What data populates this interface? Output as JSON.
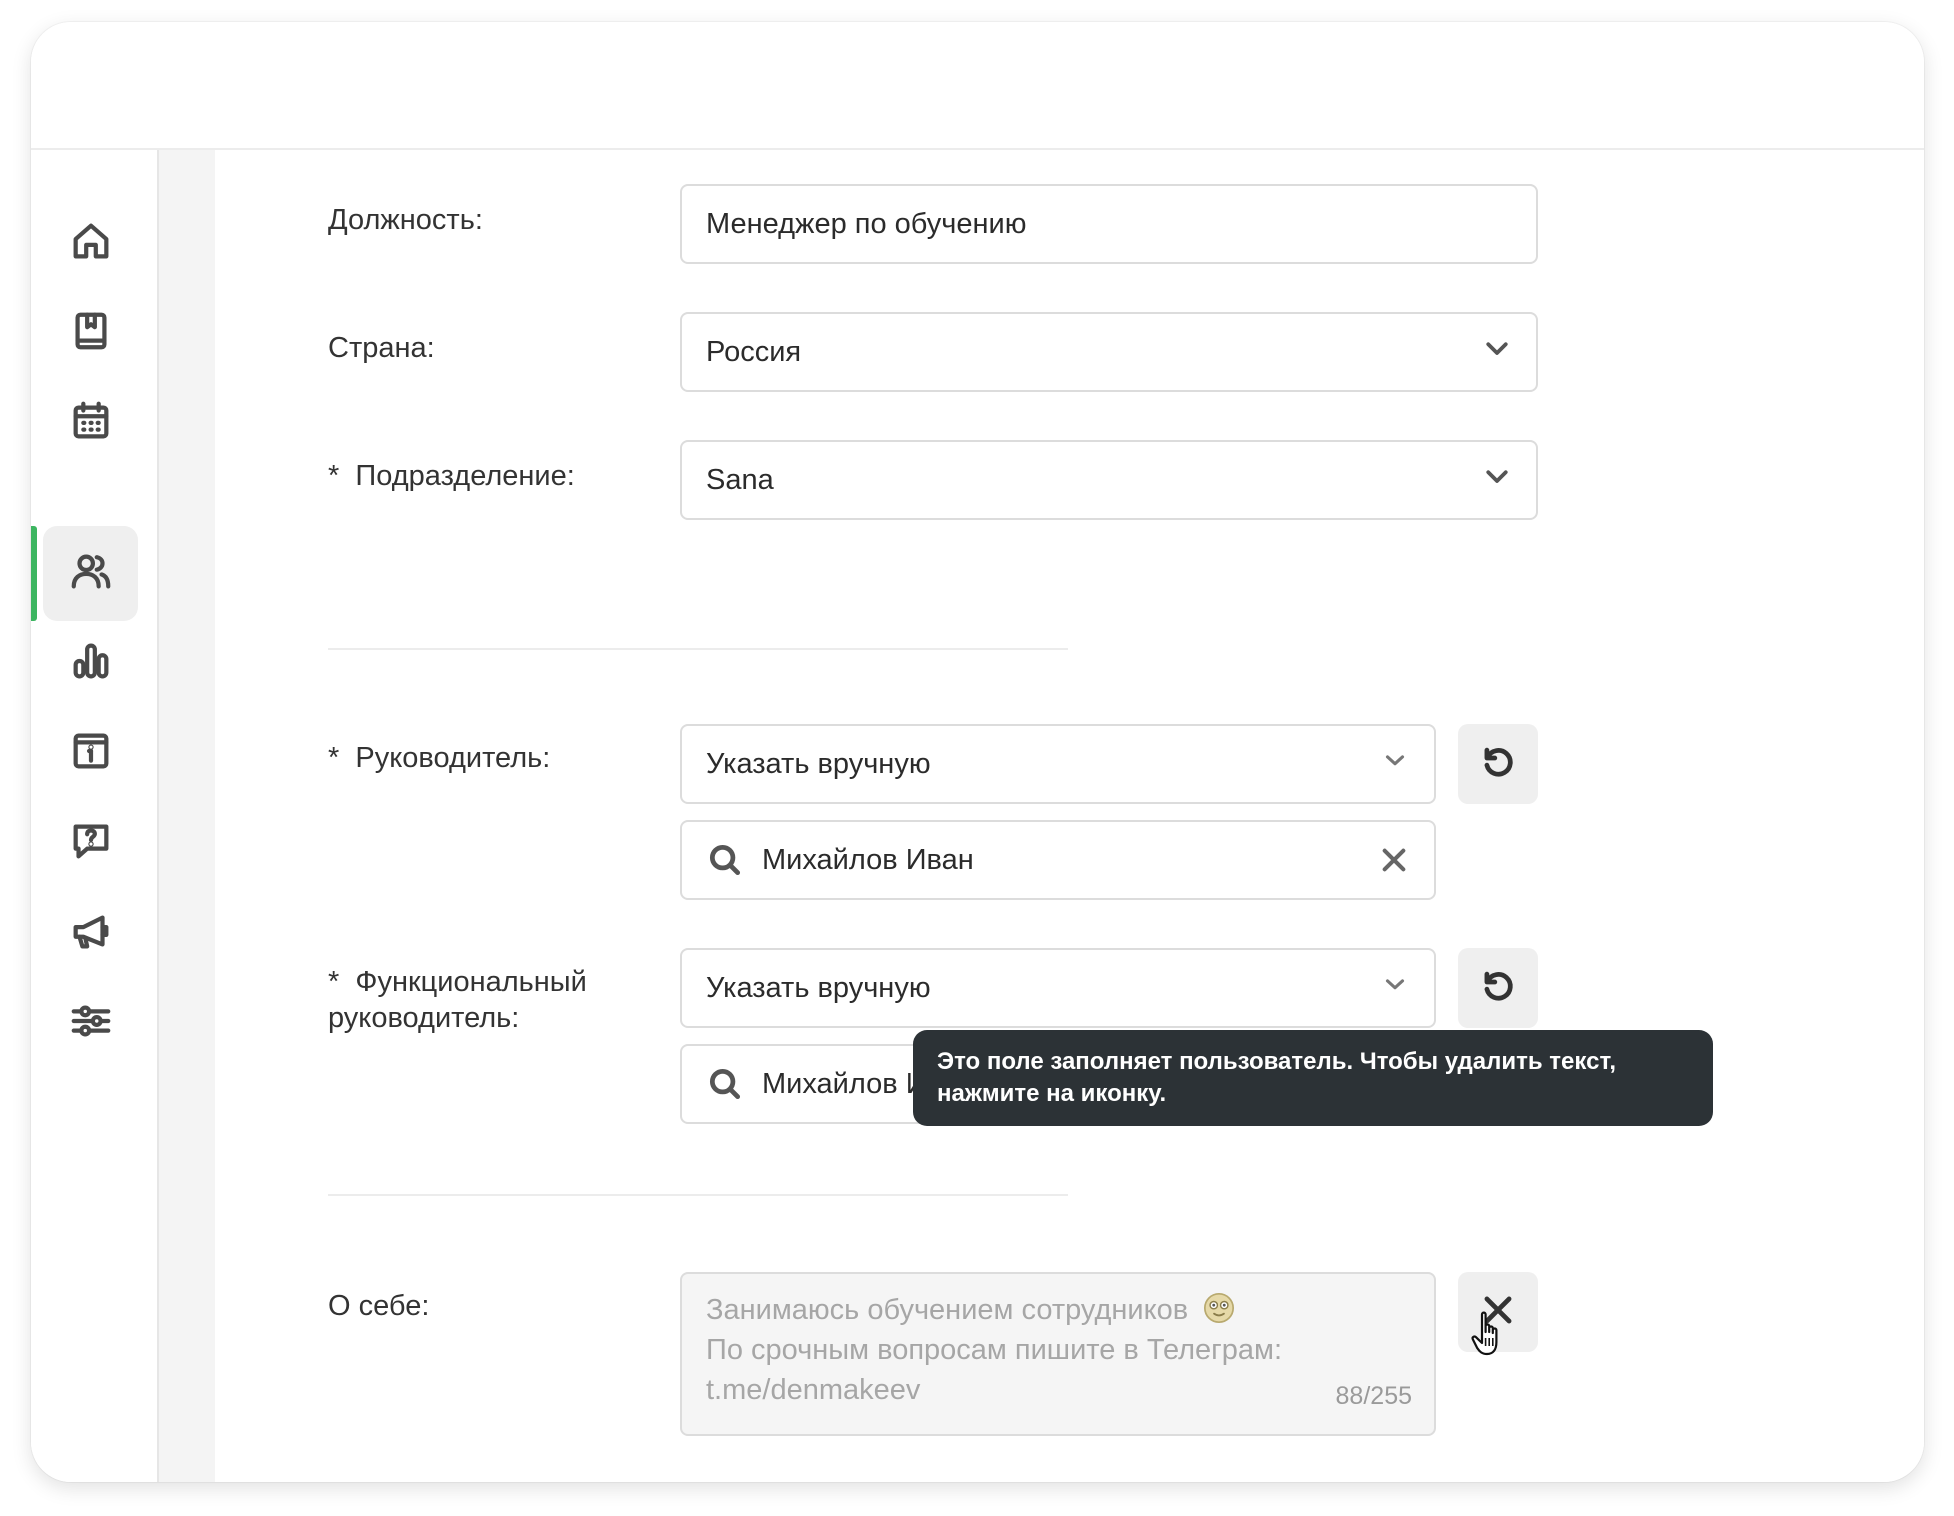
{
  "sidebar": {
    "items": [
      {
        "name": "home",
        "icon": "home-icon"
      },
      {
        "name": "courses",
        "icon": "book-icon"
      },
      {
        "name": "calendar",
        "icon": "calendar-icon"
      },
      {
        "name": "users",
        "icon": "users-icon",
        "active": true
      },
      {
        "name": "analytics",
        "icon": "bar-chart-icon"
      },
      {
        "name": "info",
        "icon": "info-icon"
      },
      {
        "name": "help",
        "icon": "question-icon"
      },
      {
        "name": "announcements",
        "icon": "megaphone-icon"
      },
      {
        "name": "settings",
        "icon": "sliders-icon"
      }
    ],
    "accent_color": "#3cb560"
  },
  "form": {
    "position": {
      "label": "Должность:",
      "value": "Менеджер по обучению"
    },
    "country": {
      "label": "Страна:",
      "value": "Россия"
    },
    "department": {
      "required": "*",
      "label": "Подразделение:",
      "value": "Sana"
    },
    "manager": {
      "required": "*",
      "label": "Руководитель:",
      "mode": "Указать вручную",
      "search_value": "Михайлов Иван"
    },
    "functional_manager": {
      "required": "*",
      "label_line1": "Функциональный",
      "label_line2": "руководитель:",
      "mode": "Указать вручную",
      "search_value": "Михайлов Иван"
    },
    "about": {
      "label": "О себе:",
      "line1": "Занимаюсь обучением сотрудников",
      "line2": "По срочным вопросам пишите в Телеграм:",
      "line3": "t.me/denmakeev",
      "counter": "88/255"
    }
  },
  "tooltip": {
    "line1": "Это поле заполняет пользователь. Чтобы удалить текст,",
    "line2": "нажмите на иконку."
  }
}
